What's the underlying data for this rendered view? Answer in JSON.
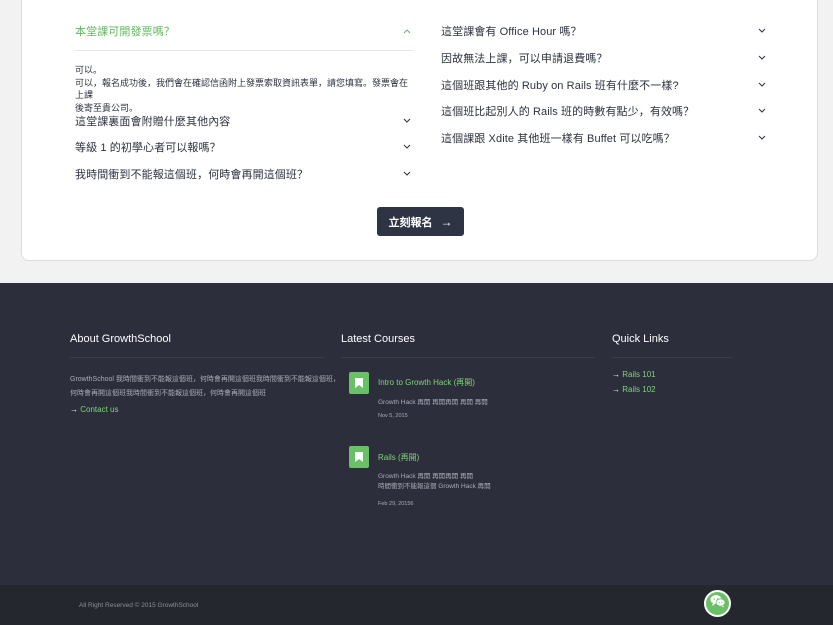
{
  "faq": {
    "left": [
      {
        "question": "本堂課可開發票嗎？",
        "open": true
      },
      {
        "question": "這堂課裏面會附贈什麼其他內容",
        "open": false
      },
      {
        "question": "等級 1 的初學心者可以報嗎？",
        "open": false
      },
      {
        "question": "我時間衝到不能報這個班，何時會再開這個班？",
        "open": false
      }
    ],
    "answer_lines": [
      "可以。",
      "可以，報名成功後，我們會在確認信函附上發票索取資訊表單，請您填寫。發票會在上課",
      "後寄至貴公司。"
    ],
    "right": [
      {
        "question": "這堂課會有 Office Hour 嗎？"
      },
      {
        "question": "因故無法上課，可以申請退費嗎？"
      },
      {
        "question": "這個班跟其他的 Ruby on Rails 班有什麼不一樣?"
      },
      {
        "question": "這個班比起別人的 Rails 班的時數有點少，有效嗎？"
      },
      {
        "question": "這個課跟 Xdite 其他班一樣有 Buffet 可以吃嗎？"
      }
    ],
    "cta_label": "立刻報名",
    "cta_arrow": "→"
  },
  "footer": {
    "about": {
      "heading": "About GrowthSchool",
      "text_lines": [
        "GrowthSchool 我時間衝到不能報這個班，何時會再開這個班我時間衝到不能報這個班，",
        "何時會再開這個班我時間衝到不能報這個班，何時會再開這個班"
      ],
      "contact_arrow": "→",
      "contact_label": "Contact us"
    },
    "courses": {
      "heading": "Latest Courses",
      "items": [
        {
          "title": "Intro to Growth Hack (再開)",
          "desc_lines": [
            "Growth Hack 再開 再開再開 再開 再開"
          ],
          "date": "Nov 5, 2015"
        },
        {
          "title": "Rails (再開)",
          "desc_lines": [
            "Growth Hack 再開 再開再開 再開",
            "時間衝到不能報這個 Growth Hack 再開"
          ],
          "date": "Feb 29, 20156"
        }
      ]
    },
    "quick_links": {
      "heading": "Quick Links",
      "items": [
        {
          "arrow": "→",
          "label": "Rails 101"
        },
        {
          "arrow": "→",
          "label": "Rails 102"
        }
      ]
    },
    "copyright": "All Right Reserved © 2015 GrowthSchool"
  },
  "icons": {
    "chevron": "chevron-icon",
    "bookmark": "bookmark-icon",
    "chat": "chat-icon"
  },
  "colors": {
    "accent_green": "#62b85f",
    "footer_bg": "#2c2f3b",
    "button_dark": "#2e3444"
  }
}
